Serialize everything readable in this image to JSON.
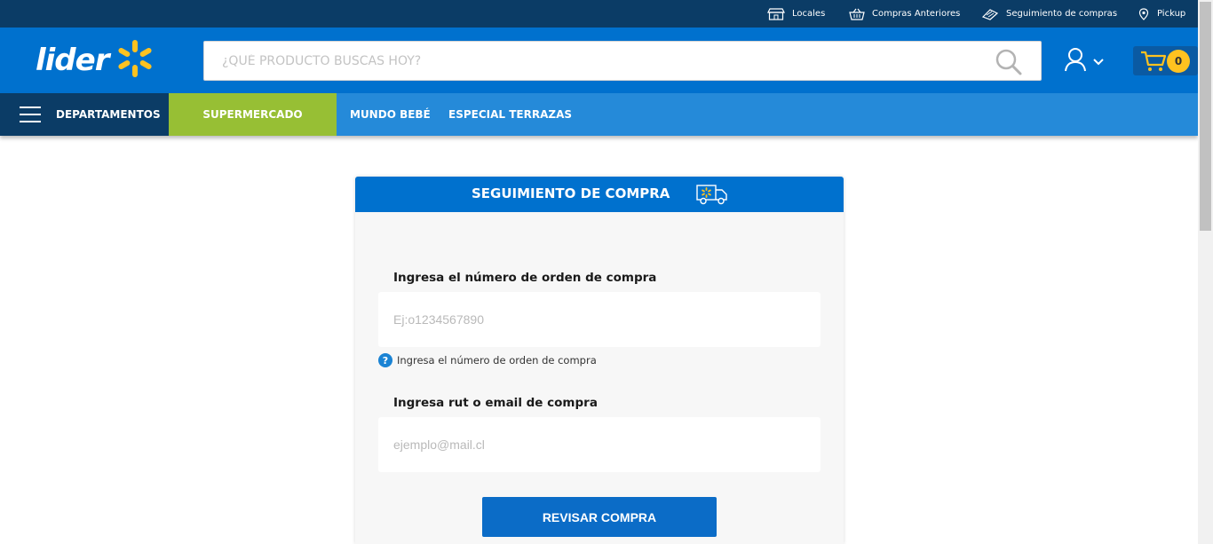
{
  "topbar": {
    "links": [
      {
        "label": "Locales",
        "icon": "store-icon"
      },
      {
        "label": "Compras Anteriores",
        "icon": "basket-icon"
      },
      {
        "label": "Seguimiento de compras",
        "icon": "tracking-icon"
      },
      {
        "label": "Pickup",
        "icon": "location-pin-icon"
      }
    ]
  },
  "header": {
    "logo_text": "lider",
    "search_placeholder": "¿QUÉ PRODUCTO BUSCAS HOY?",
    "cart_count": "0"
  },
  "nav": {
    "departments_label": "DEPARTAMENTOS",
    "supermercado_label": "SUPERMERCADO",
    "links": [
      "MUNDO BEBÉ",
      "ESPECIAL TERRAZAS"
    ]
  },
  "tracking_form": {
    "title": "SEGUIMIENTO DE COMPRA",
    "order_label": "Ingresa el número de orden de compra",
    "order_placeholder": "Ej:o1234567890",
    "order_hint": "Ingresa el número de orden de compra",
    "rut_label": "Ingresa rut o email de compra",
    "rut_placeholder": "ejemplo@mail.cl",
    "submit_label": "REVISAR COMPRA"
  },
  "colors": {
    "header_blue": "#0071ce",
    "topbar_navy": "#0b3c66",
    "nav_blue": "#258ad9",
    "supermercado_green": "#97bf34",
    "spark_yellow": "#ffc220"
  }
}
